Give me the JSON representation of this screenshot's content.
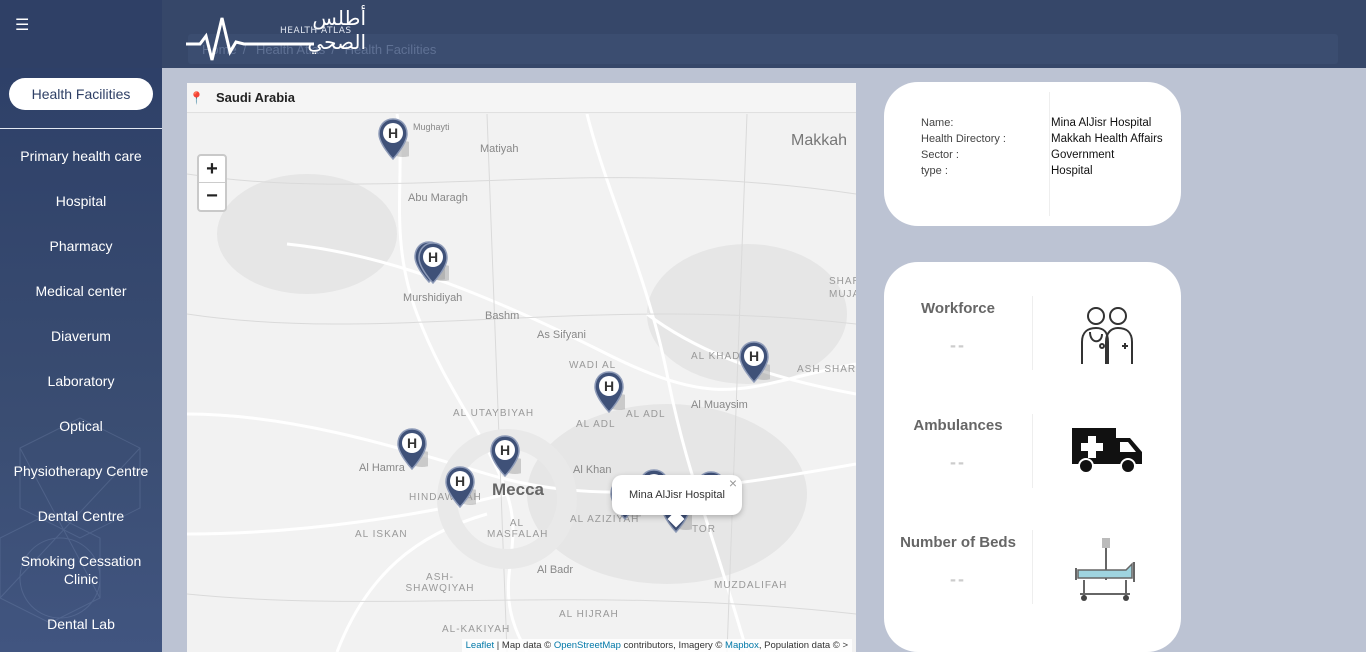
{
  "header": {
    "logo_ar": "أطلس الصحي",
    "logo_en": "HEALTH ATLAS",
    "breadcrumb": [
      "Home",
      "Health Atlas",
      "Health Facilities"
    ]
  },
  "sidebar": {
    "active_label": "Health Facilities",
    "items": [
      {
        "label": "Primary health care"
      },
      {
        "label": "Hospital"
      },
      {
        "label": "Pharmacy"
      },
      {
        "label": "Medical center"
      },
      {
        "label": "Diaverum"
      },
      {
        "label": "Laboratory"
      },
      {
        "label": "Optical"
      },
      {
        "label": "Physiotherapy Centre"
      },
      {
        "label": "Dental Centre"
      },
      {
        "label": "Smoking Cessation Clinic"
      },
      {
        "label": "Dental Lab"
      }
    ]
  },
  "map": {
    "region": "Saudi Arabia",
    "zoom_in": "+",
    "zoom_out": "−",
    "popup_title": "Mina AlJisr Hospital",
    "popup_close": "×",
    "places": {
      "makkah": "Makkah",
      "matiyah": "Matiyah",
      "abu_maragh": "Abu Maragh",
      "murshidiyah": "Murshidiyah",
      "bashm": "Bashm",
      "as_sifyani": "As Sifyani",
      "wadi_al": "WADI AL",
      "al_utaybiyah": "AL UTAYBIYAH",
      "al_adl": "AL ADL",
      "al_hamra": "Al Hamra",
      "al_khan": "Al Khan",
      "mecca": "Mecca",
      "hindawiyah": "HINDAWIYAH",
      "al_aziziyah": "AL AZIZIYAH",
      "al_iskan": "AL ISKAN",
      "al_masfalah": "AL MASFALAH",
      "al_khad": "AL KHAD",
      "ash_shara": "ASH SHARA",
      "al_muaysim": "Al Muaysim",
      "al_badr": "Al Badr",
      "ash_shawqiyah": "ASH-SHAWQIYAH",
      "muzdalifah": "MUZDALIFAH",
      "al_hijrah": "AL HIJRAH",
      "al_kakiyah": "AL-KAKIYAH",
      "shar": "SHAR",
      "muja": "MUJA",
      "tor": "TOR",
      "mughayti": "Mughayti"
    },
    "attribution": {
      "leaflet": "Leaflet",
      "sep1": " | Map data © ",
      "osm": "OpenStreetMap",
      "mid": " contributors, Imagery © ",
      "mapbox": "Mapbox",
      "end": ", Population data © >"
    }
  },
  "facility": {
    "labels": {
      "name": "Name:",
      "directory": "Health Directory :",
      "sector": "Sector :",
      "type": "type :"
    },
    "name": "Mina AlJisr Hospital",
    "directory": "Makkah Health Affairs",
    "sector": "Government",
    "type": "Hospital"
  },
  "stats": {
    "workforce": {
      "title": "Workforce",
      "value": "--"
    },
    "ambulances": {
      "title": "Ambulances",
      "value": "--"
    },
    "beds": {
      "title": "Number of Beds",
      "value": "--"
    }
  },
  "colors": {
    "sidebar": "#2f4066",
    "topbar": "#364769",
    "background": "#bcc3d3",
    "marker": "#3f5178"
  }
}
